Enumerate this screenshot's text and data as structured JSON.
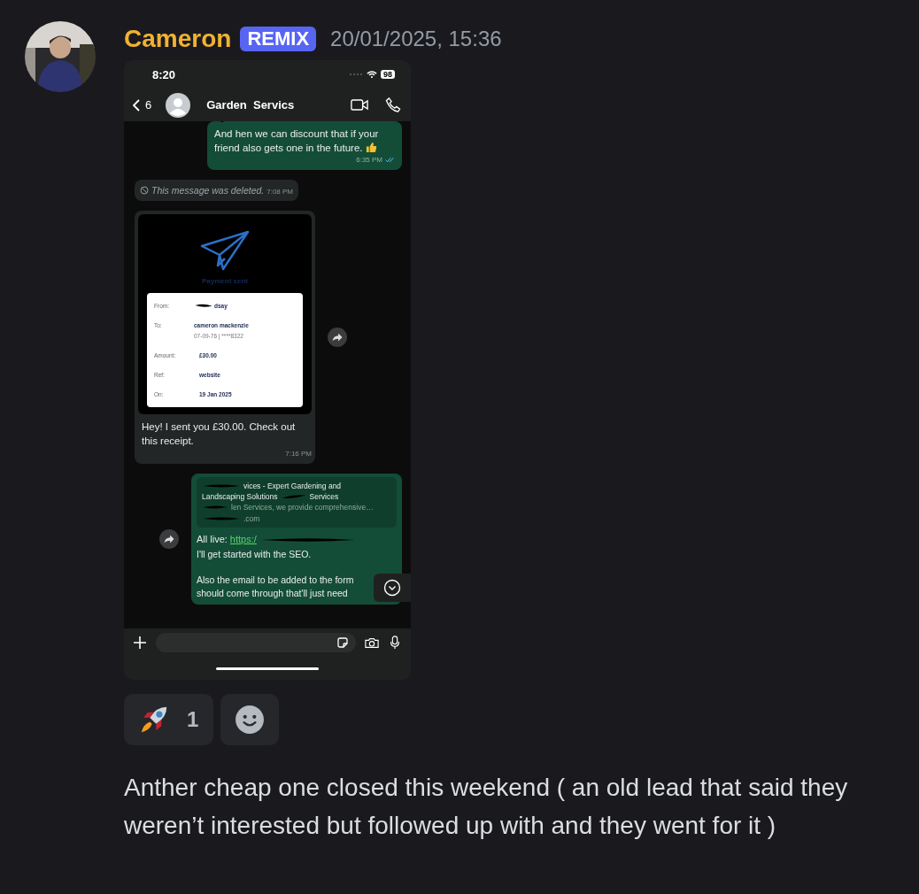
{
  "message": {
    "author": "Cameron",
    "badge": "REMIX",
    "timestamp": "20/01/2025, 15:36",
    "text": "Anther cheap one closed this weekend ( an old lead that said they weren’t interested but followed up with and they went for it )"
  },
  "phone": {
    "time": "8:20",
    "battery": "98",
    "back_count": "6",
    "contact": "Garden  Servics",
    "messages": [
      {
        "kind": "text",
        "outgoing": true,
        "text": "And  hen we can discount that if your friend also gets one in the future.",
        "time": "6:35 PM",
        "read": true
      },
      {
        "kind": "deleted",
        "outgoing": false,
        "text": "This message was deleted.",
        "time": "7:08 PM"
      },
      {
        "kind": "receipt",
        "outgoing": false,
        "forward": true,
        "title": "Payment sent",
        "fields": [
          {
            "label": "From:",
            "value": "dsay"
          },
          {
            "label": "To:",
            "value": "cameron mackenzie",
            "sub": "07-09-76 | ****8322"
          },
          {
            "label": "Amount:",
            "value": "£30.00"
          },
          {
            "label": "Ref:",
            "value": "website"
          },
          {
            "label": "On:",
            "value": "19 Jan 2025"
          }
        ],
        "text": "Hey! I sent you £30.00. Check out this receipt.",
        "time": "7:16 PM"
      },
      {
        "kind": "link",
        "outgoing": true,
        "forward": true,
        "preview_lines": [
          "vices - Expert Gardening and",
          "Landscaping Solutions",
          "Services"
        ],
        "preview_desc": "len Services, we provide comprehensive…",
        "preview_domain": ".com",
        "link_prefix": "All live:",
        "link": "https:/",
        "paragraphs": [
          "I'll get started with the SEO.",
          "Also the email to be added to the form should come through that'll just need"
        ]
      }
    ]
  },
  "reactions": [
    {
      "kind": "rocket",
      "count": "1",
      "selected": false
    }
  ]
}
